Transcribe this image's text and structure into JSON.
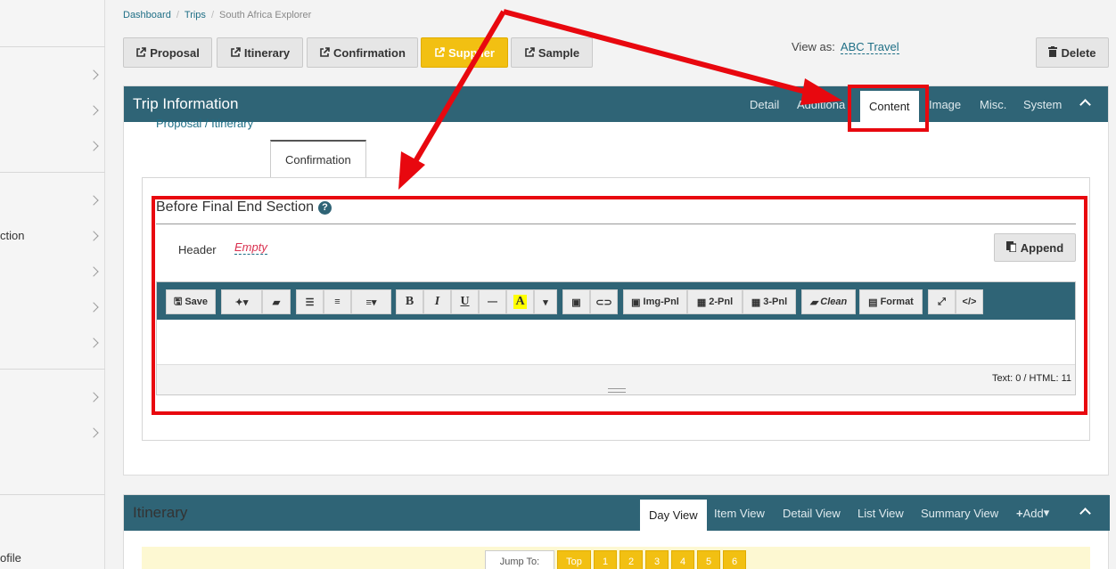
{
  "sidebar": {
    "partial_labels": [
      "ction",
      "ofile"
    ]
  },
  "breadcrumb": {
    "items": [
      "Dashboard",
      "Trips"
    ],
    "current": "South Africa Explorer"
  },
  "doc_buttons": [
    "Proposal",
    "Itinerary",
    "Confirmation",
    "Supplier",
    "Sample"
  ],
  "view_as": {
    "label": "View as:",
    "value": "ABC Travel"
  },
  "delete_label": "Delete",
  "trip_info": {
    "title": "Trip Information",
    "tabs": [
      "Detail",
      "Additiona",
      "Content",
      "Image",
      "Misc.",
      "System"
    ],
    "selected_tab": "Content",
    "subtabs": [
      "Proposal / Itinerary",
      "Confirmation"
    ],
    "section": {
      "title": "Before Final End Section",
      "header_label": "Header",
      "header_value": "Empty",
      "append_label": "Append",
      "toolbar": {
        "save": "Save",
        "img_pnl": "Img-Pnl",
        "two_pnl": "2-Pnl",
        "three_pnl": "3-Pnl",
        "clean": "Clean",
        "format": "Format",
        "code": "</>"
      },
      "counts": "Text: 0 / HTML: 11"
    }
  },
  "itinerary": {
    "title": "Itinerary",
    "tabs": [
      "Day View",
      "Item View",
      "Detail View",
      "List View",
      "Summary View"
    ],
    "selected_tab": "Day View",
    "add_label": "Add",
    "jump_label": "Jump To:",
    "jump_buttons": [
      "Top",
      "1",
      "2",
      "3",
      "4",
      "5",
      "6"
    ]
  },
  "colors": {
    "header": "#2f6476",
    "accent": "#f2c012",
    "annotation": "#e8080f"
  }
}
